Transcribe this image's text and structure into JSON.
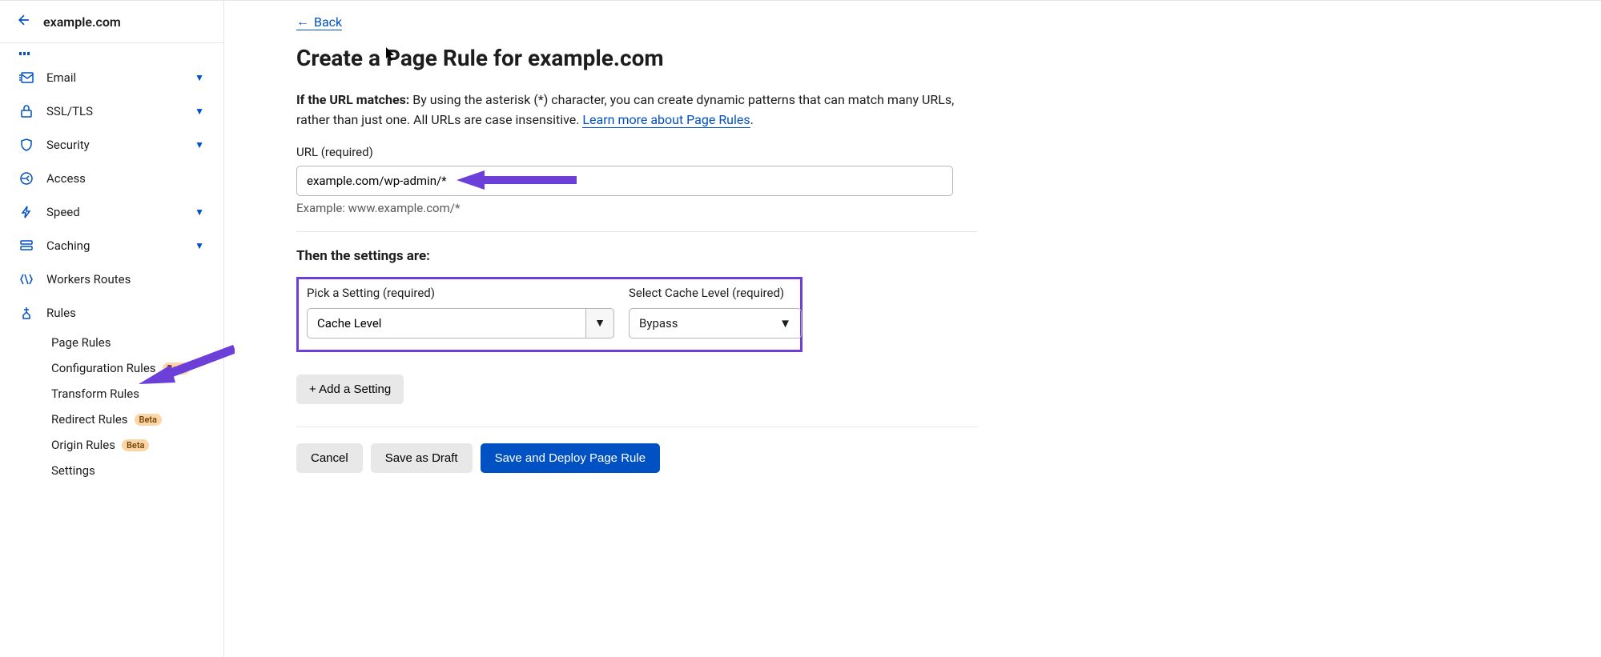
{
  "site_name": "example.com",
  "sidebar": {
    "items": [
      {
        "label": "Email",
        "icon": "email-icon",
        "expandable": true
      },
      {
        "label": "SSL/TLS",
        "icon": "lock-icon",
        "expandable": true
      },
      {
        "label": "Security",
        "icon": "shield-icon",
        "expandable": true
      },
      {
        "label": "Access",
        "icon": "access-icon",
        "expandable": false
      },
      {
        "label": "Speed",
        "icon": "bolt-icon",
        "expandable": true
      },
      {
        "label": "Caching",
        "icon": "caching-icon",
        "expandable": true
      },
      {
        "label": "Workers Routes",
        "icon": "workers-icon",
        "expandable": false
      },
      {
        "label": "Rules",
        "icon": "rules-icon",
        "expandable": false
      }
    ],
    "rules_sub": [
      {
        "label": "Page Rules",
        "beta": false
      },
      {
        "label": "Configuration Rules",
        "beta": true
      },
      {
        "label": "Transform Rules",
        "beta": false
      },
      {
        "label": "Redirect Rules",
        "beta": true
      },
      {
        "label": "Origin Rules",
        "beta": true
      },
      {
        "label": "Settings",
        "beta": false
      }
    ],
    "beta_badge": "Beta"
  },
  "back_link": "Back",
  "page_title": "Create a Page Rule for example.com",
  "desc_strong": "If the URL matches:",
  "desc_text": " By using the asterisk (*) character, you can create dynamic patterns that can match many URLs, rather than just one. All URLs are case insensitive. ",
  "desc_link": "Learn more about Page Rules",
  "url_label": "URL (required)",
  "url_value": "example.com/wp-admin/*",
  "url_example": "Example: www.example.com/*",
  "settings_title": "Then the settings are:",
  "pick_label": "Pick a Setting (required)",
  "pick_value": "Cache Level",
  "cache_label": "Select Cache Level (required)",
  "cache_value": "Bypass",
  "add_setting": "+ Add a Setting",
  "cancel": "Cancel",
  "save_draft": "Save as Draft",
  "save_deploy": "Save and Deploy Page Rule"
}
